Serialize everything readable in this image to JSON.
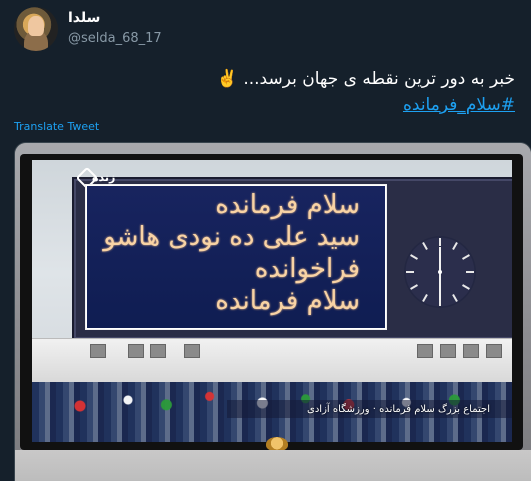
{
  "tweet": {
    "display_name": "سلدا",
    "handle": "@selda_68_17",
    "text": "خبر به دور ترین نقطه ی جهان برسد... ✌️",
    "hashtag": "#سلام_فرمانده",
    "translate_label": "Translate Tweet"
  },
  "media": {
    "live_label": "زنده",
    "board_lines": [
      "سلام فرمانده",
      "سید علی ده نودی هاشو",
      "فراخوانده",
      "سلام فرمانده"
    ],
    "ticker_text": "اجتماع بزرگ سلام فرمانده · ورزشگاه آزادی"
  },
  "colors": {
    "background": "#15202b",
    "link": "#1da1f2",
    "muted": "#8899a6"
  },
  "icons": {
    "avatar": "profile-avatar",
    "tv_logo": "tv-logo-icon",
    "live_logo": "live-channel-icon"
  }
}
